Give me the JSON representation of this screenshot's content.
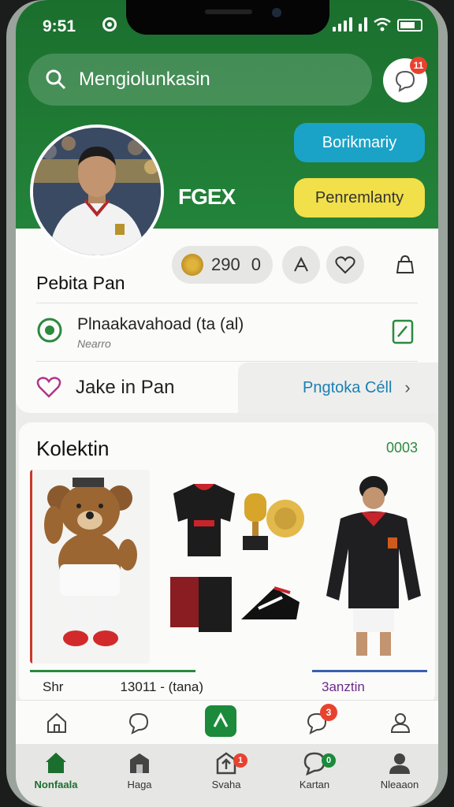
{
  "status": {
    "time": "9:51"
  },
  "search": {
    "placeholder": "Mengiolunkasin"
  },
  "chat": {
    "badge": "11"
  },
  "profile": {
    "brand": "FGEX",
    "follow_label": "Borikmariy",
    "report_label": "Penremlanty",
    "name": "Pebita Pan",
    "coins": "290",
    "coins_suffix": "0"
  },
  "info_row": {
    "title": "Plnaakavahoad (ta (al)",
    "subtitle": "Nearro"
  },
  "fav_row": {
    "label": "Jake in Pan",
    "link": "Pngtoka Céll"
  },
  "collection": {
    "title": "Kolektin",
    "count": "0003",
    "strip": {
      "left": "Shr",
      "mid": "13011 - (tana)",
      "right": "3anztin"
    }
  },
  "nav": {
    "badges": {
      "chat_top": "3",
      "upload": "1",
      "message": "0"
    },
    "tabs": [
      {
        "label": "Nonfaala"
      },
      {
        "label": "Haga"
      },
      {
        "label": "Svaha"
      },
      {
        "label": "Kartan"
      },
      {
        "label": "Nleaaon"
      }
    ]
  },
  "colors": {
    "header_green": "#1b6f2e",
    "follow_button": "#1aa3c7",
    "report_button": "#f1e04a",
    "badge_red": "#e8422f",
    "link_blue": "#1b7fb3"
  }
}
